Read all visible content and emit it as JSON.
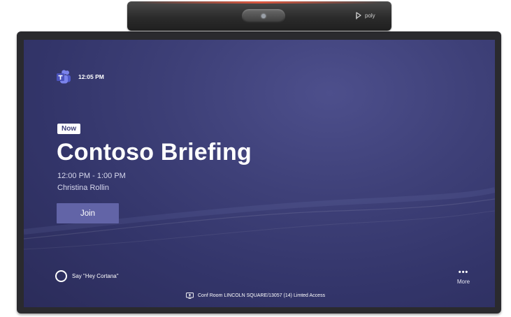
{
  "device": {
    "brand": "poly"
  },
  "status": {
    "time": "12:05 PM",
    "app_icon": "microsoft-teams-icon"
  },
  "meeting": {
    "badge": "Now",
    "title": "Contoso Briefing",
    "time_range": "12:00 PM - 1:00 PM",
    "organizer": "Christina Rollin",
    "join_label": "Join"
  },
  "footer": {
    "cortana_label": "Say \"Hey Cortana\"",
    "more_label": "More",
    "room_label": "Conf Room LINCOLN SQUARE/13057 (14) Limted Access"
  },
  "colors": {
    "background": "#3e4078",
    "accent": "#6264a7",
    "text": "#ffffff"
  }
}
